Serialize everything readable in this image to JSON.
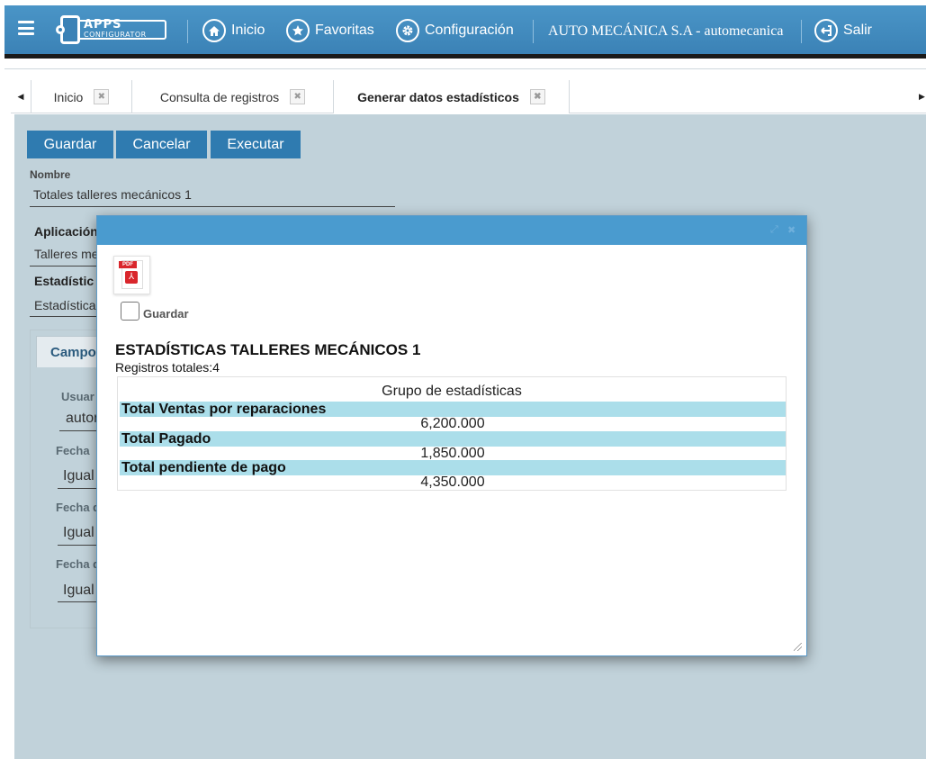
{
  "header": {
    "logo_line1": "APPS",
    "logo_line2": "CONFIGURATOR",
    "nav": [
      {
        "label": "Inicio",
        "icon": "home-icon"
      },
      {
        "label": "Favoritas",
        "icon": "star-icon"
      },
      {
        "label": "Configuración",
        "icon": "gear-icon"
      }
    ],
    "company": "AUTO MECÁNICA S.A - automecanica",
    "logout_label": "Salir",
    "logout_icon": "logout-icon",
    "bar_color": "#3b82b6"
  },
  "tabs": [
    {
      "label": "Inicio",
      "close_icon": "close-icon"
    },
    {
      "label": "Consulta de registros",
      "close_icon": "close-icon"
    },
    {
      "label": "Generar datos estadísticos",
      "close_icon": "close-icon",
      "active": true
    }
  ],
  "toolbar": {
    "save_label": "Guardar",
    "cancel_label": "Cancelar",
    "execute_label": "Executar",
    "button_color": "#2f7bb0"
  },
  "form": {
    "name_label": "Nombre",
    "name_value": "Totales talleres mecánicos 1",
    "app_label": "Aplicación",
    "app_value": "Talleres me",
    "stats_label": "Estadístic",
    "stats_value": "Estadística",
    "campos_tab": "Campo",
    "user_label": "Usuar",
    "user_value": "autor",
    "fecha1_label": "Fecha",
    "fecha1_value": "Igual",
    "fecha2_label": "Fecha d",
    "fecha2_value": "Igual",
    "fecha3_label": "Fecha d",
    "fecha3_value": "Igual"
  },
  "modal": {
    "pdf_icon": "pdf-file-icon",
    "pdf_tag": "PDF",
    "save_checkbox_label": "Guardar",
    "save_checked": false,
    "report_title": "ESTADÍSTICAS TALLERES MECÁNICOS 1",
    "records_total": "Registros totales:4",
    "group_header": "Grupo de estadísticas",
    "stats": [
      {
        "label": "Total Ventas por reparaciones",
        "value": "6,200.000"
      },
      {
        "label": "Total Pagado",
        "value": "1,850.000"
      },
      {
        "label": "Total pendiente de pago",
        "value": "4,350.000"
      }
    ],
    "row_highlight_color": "#abdeea"
  }
}
